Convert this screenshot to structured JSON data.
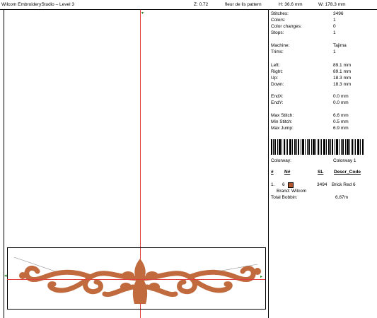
{
  "header": {
    "app_title": "Wilcom EmbroideryStudio – Level 3",
    "zoom": "Z: 0.72",
    "design_name": "fleur de lis pattern",
    "height": "H: 36.6 mm",
    "width": "W: 178.3 mm"
  },
  "stats": [
    {
      "label": "Stitches:",
      "value": "3496"
    },
    {
      "label": "Colors:",
      "value": "1"
    },
    {
      "label": "Color changes:",
      "value": "0"
    },
    {
      "label": "Stops:",
      "value": "1"
    },
    {
      "label": "Machine:",
      "value": "Tajima"
    },
    {
      "label": "Trims:",
      "value": "1"
    },
    {
      "label": "Left:",
      "value": "89.1 mm"
    },
    {
      "label": "Right:",
      "value": "89.1 mm"
    },
    {
      "label": "Up:",
      "value": "18.3 mm"
    },
    {
      "label": "Down:",
      "value": "18.3 mm"
    },
    {
      "label": "EndX:",
      "value": "0.0 mm"
    },
    {
      "label": "EndY:",
      "value": "0.0 mm"
    },
    {
      "label": "Max Stitch:",
      "value": "6.6 mm"
    },
    {
      "label": "Min Stitch:",
      "value": "0.5 mm"
    },
    {
      "label": "Max Jump:",
      "value": "6.9 mm"
    }
  ],
  "colorway": {
    "label": "Colorway:",
    "value": "Colorway 1"
  },
  "table": {
    "headers": {
      "num": "#",
      "needle": "N#",
      "stitches": "SL",
      "desc": "Descr_Code"
    },
    "row": {
      "num": "1.",
      "needle": "6",
      "stitches": "3494",
      "desc": "Brick Red 6",
      "brand": "Brand: Wilcom"
    },
    "swatch_color": "#b5572c"
  },
  "bobbin": {
    "label": "Total Bobbin:",
    "value": "6.87m"
  },
  "canvas": {
    "thread_color": "#c06a3e",
    "guide_color": "#e04040"
  }
}
